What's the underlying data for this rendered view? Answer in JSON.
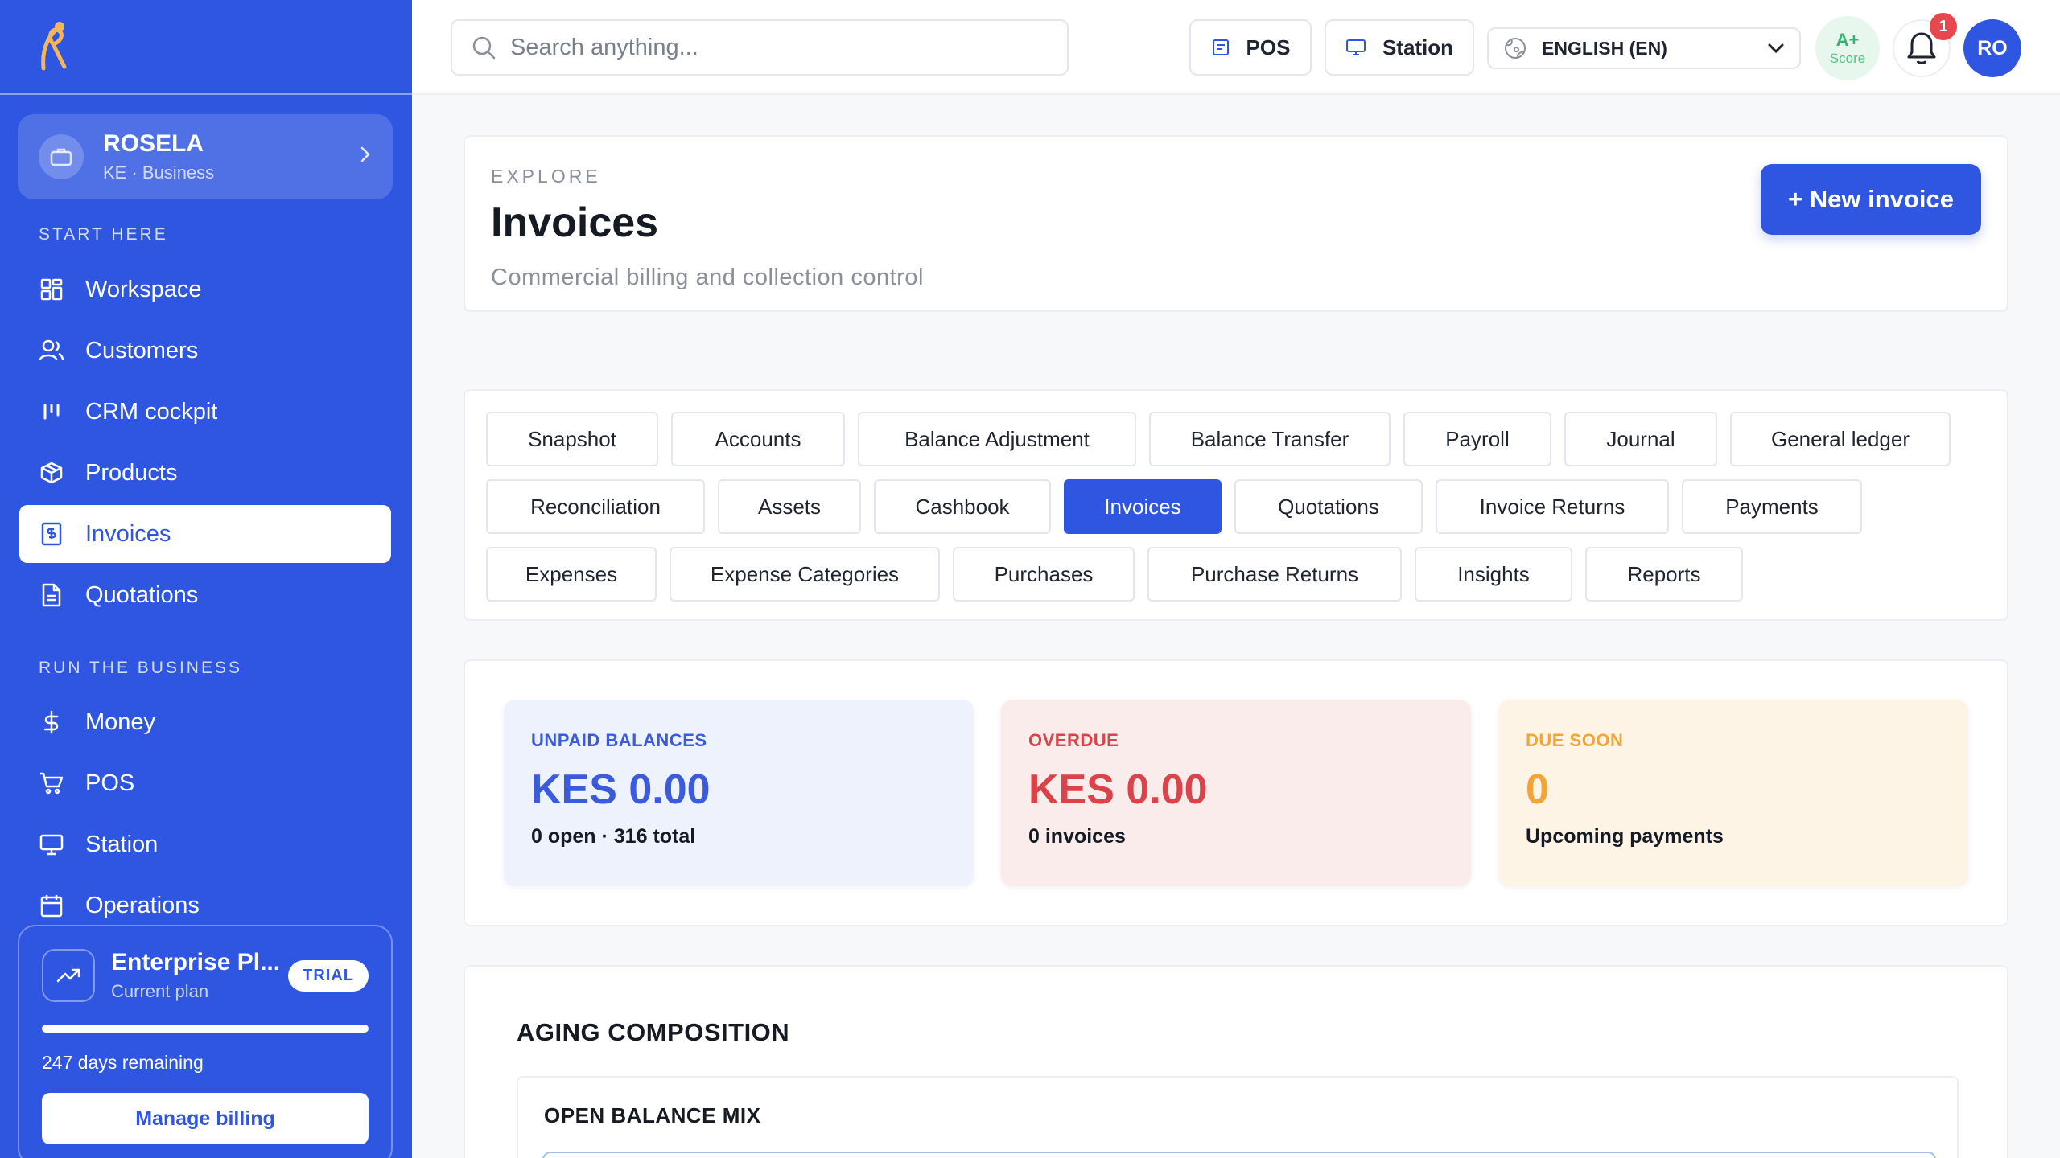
{
  "sidebar": {
    "org": {
      "name": "ROSELA",
      "subtitle": "KE · Business"
    },
    "sections": [
      {
        "label": "START HERE"
      },
      {
        "label": "RUN THE BUSINESS"
      }
    ],
    "items": [
      {
        "label": "Workspace",
        "icon": "grid-icon"
      },
      {
        "label": "Customers",
        "icon": "users-icon"
      },
      {
        "label": "CRM cockpit",
        "icon": "bars-icon"
      },
      {
        "label": "Products",
        "icon": "box-icon"
      },
      {
        "label": "Invoices",
        "icon": "invoice-icon",
        "active": true
      },
      {
        "label": "Quotations",
        "icon": "document-icon"
      },
      {
        "label": "Money",
        "icon": "dollar-icon"
      },
      {
        "label": "POS",
        "icon": "cart-icon"
      },
      {
        "label": "Station",
        "icon": "monitor-icon"
      },
      {
        "label": "Operations",
        "icon": "calendar-icon"
      }
    ],
    "plan": {
      "name": "Enterprise Pl...",
      "subtitle": "Current plan",
      "badge": "TRIAL",
      "progress": 1.0,
      "days": "247 days remaining",
      "button": "Manage billing"
    }
  },
  "topbar": {
    "search_placeholder": "Search anything...",
    "pos_label": "POS",
    "station_label": "Station",
    "language": "ENGLISH (EN)",
    "score_grade": "A+",
    "score_label": "Score",
    "notifications": "1",
    "avatar_initials": "RO"
  },
  "header": {
    "eyebrow": "EXPLORE",
    "title": "Invoices",
    "subtitle": "Commercial billing and collection control",
    "new_button": "+ New invoice"
  },
  "tabs": [
    {
      "label": "Snapshot"
    },
    {
      "label": "Accounts"
    },
    {
      "label": "Balance Adjustment"
    },
    {
      "label": "Balance Transfer"
    },
    {
      "label": "Payroll"
    },
    {
      "label": "Journal"
    },
    {
      "label": "General ledger"
    },
    {
      "label": "Reconciliation"
    },
    {
      "label": "Assets"
    },
    {
      "label": "Cashbook"
    },
    {
      "label": "Invoices",
      "active": true
    },
    {
      "label": "Quotations"
    },
    {
      "label": "Invoice Returns"
    },
    {
      "label": "Payments"
    },
    {
      "label": "Expenses"
    },
    {
      "label": "Expense Categories"
    },
    {
      "label": "Purchases"
    },
    {
      "label": "Purchase Returns"
    },
    {
      "label": "Insights"
    },
    {
      "label": "Reports"
    }
  ],
  "stats": [
    {
      "label": "UNPAID BALANCES",
      "value": "KES 0.00",
      "sub": "0 open · 316 total",
      "color": "#3b5bdb",
      "bg": "#eef2fd"
    },
    {
      "label": "OVERDUE",
      "value": "KES 0.00",
      "sub": "0 invoices",
      "color": "#d9434a",
      "bg": "#fbecec"
    },
    {
      "label": "DUE SOON",
      "value": "0",
      "sub": "Upcoming payments",
      "color": "#f0a43a",
      "bg": "#fdf4e6"
    }
  ],
  "aging": {
    "title": "AGING COMPOSITION",
    "mix_title": "OPEN BALANCE MIX"
  },
  "colors": {
    "brand": "#2f56e0",
    "success": "#38b26c",
    "danger": "#e5484d"
  }
}
